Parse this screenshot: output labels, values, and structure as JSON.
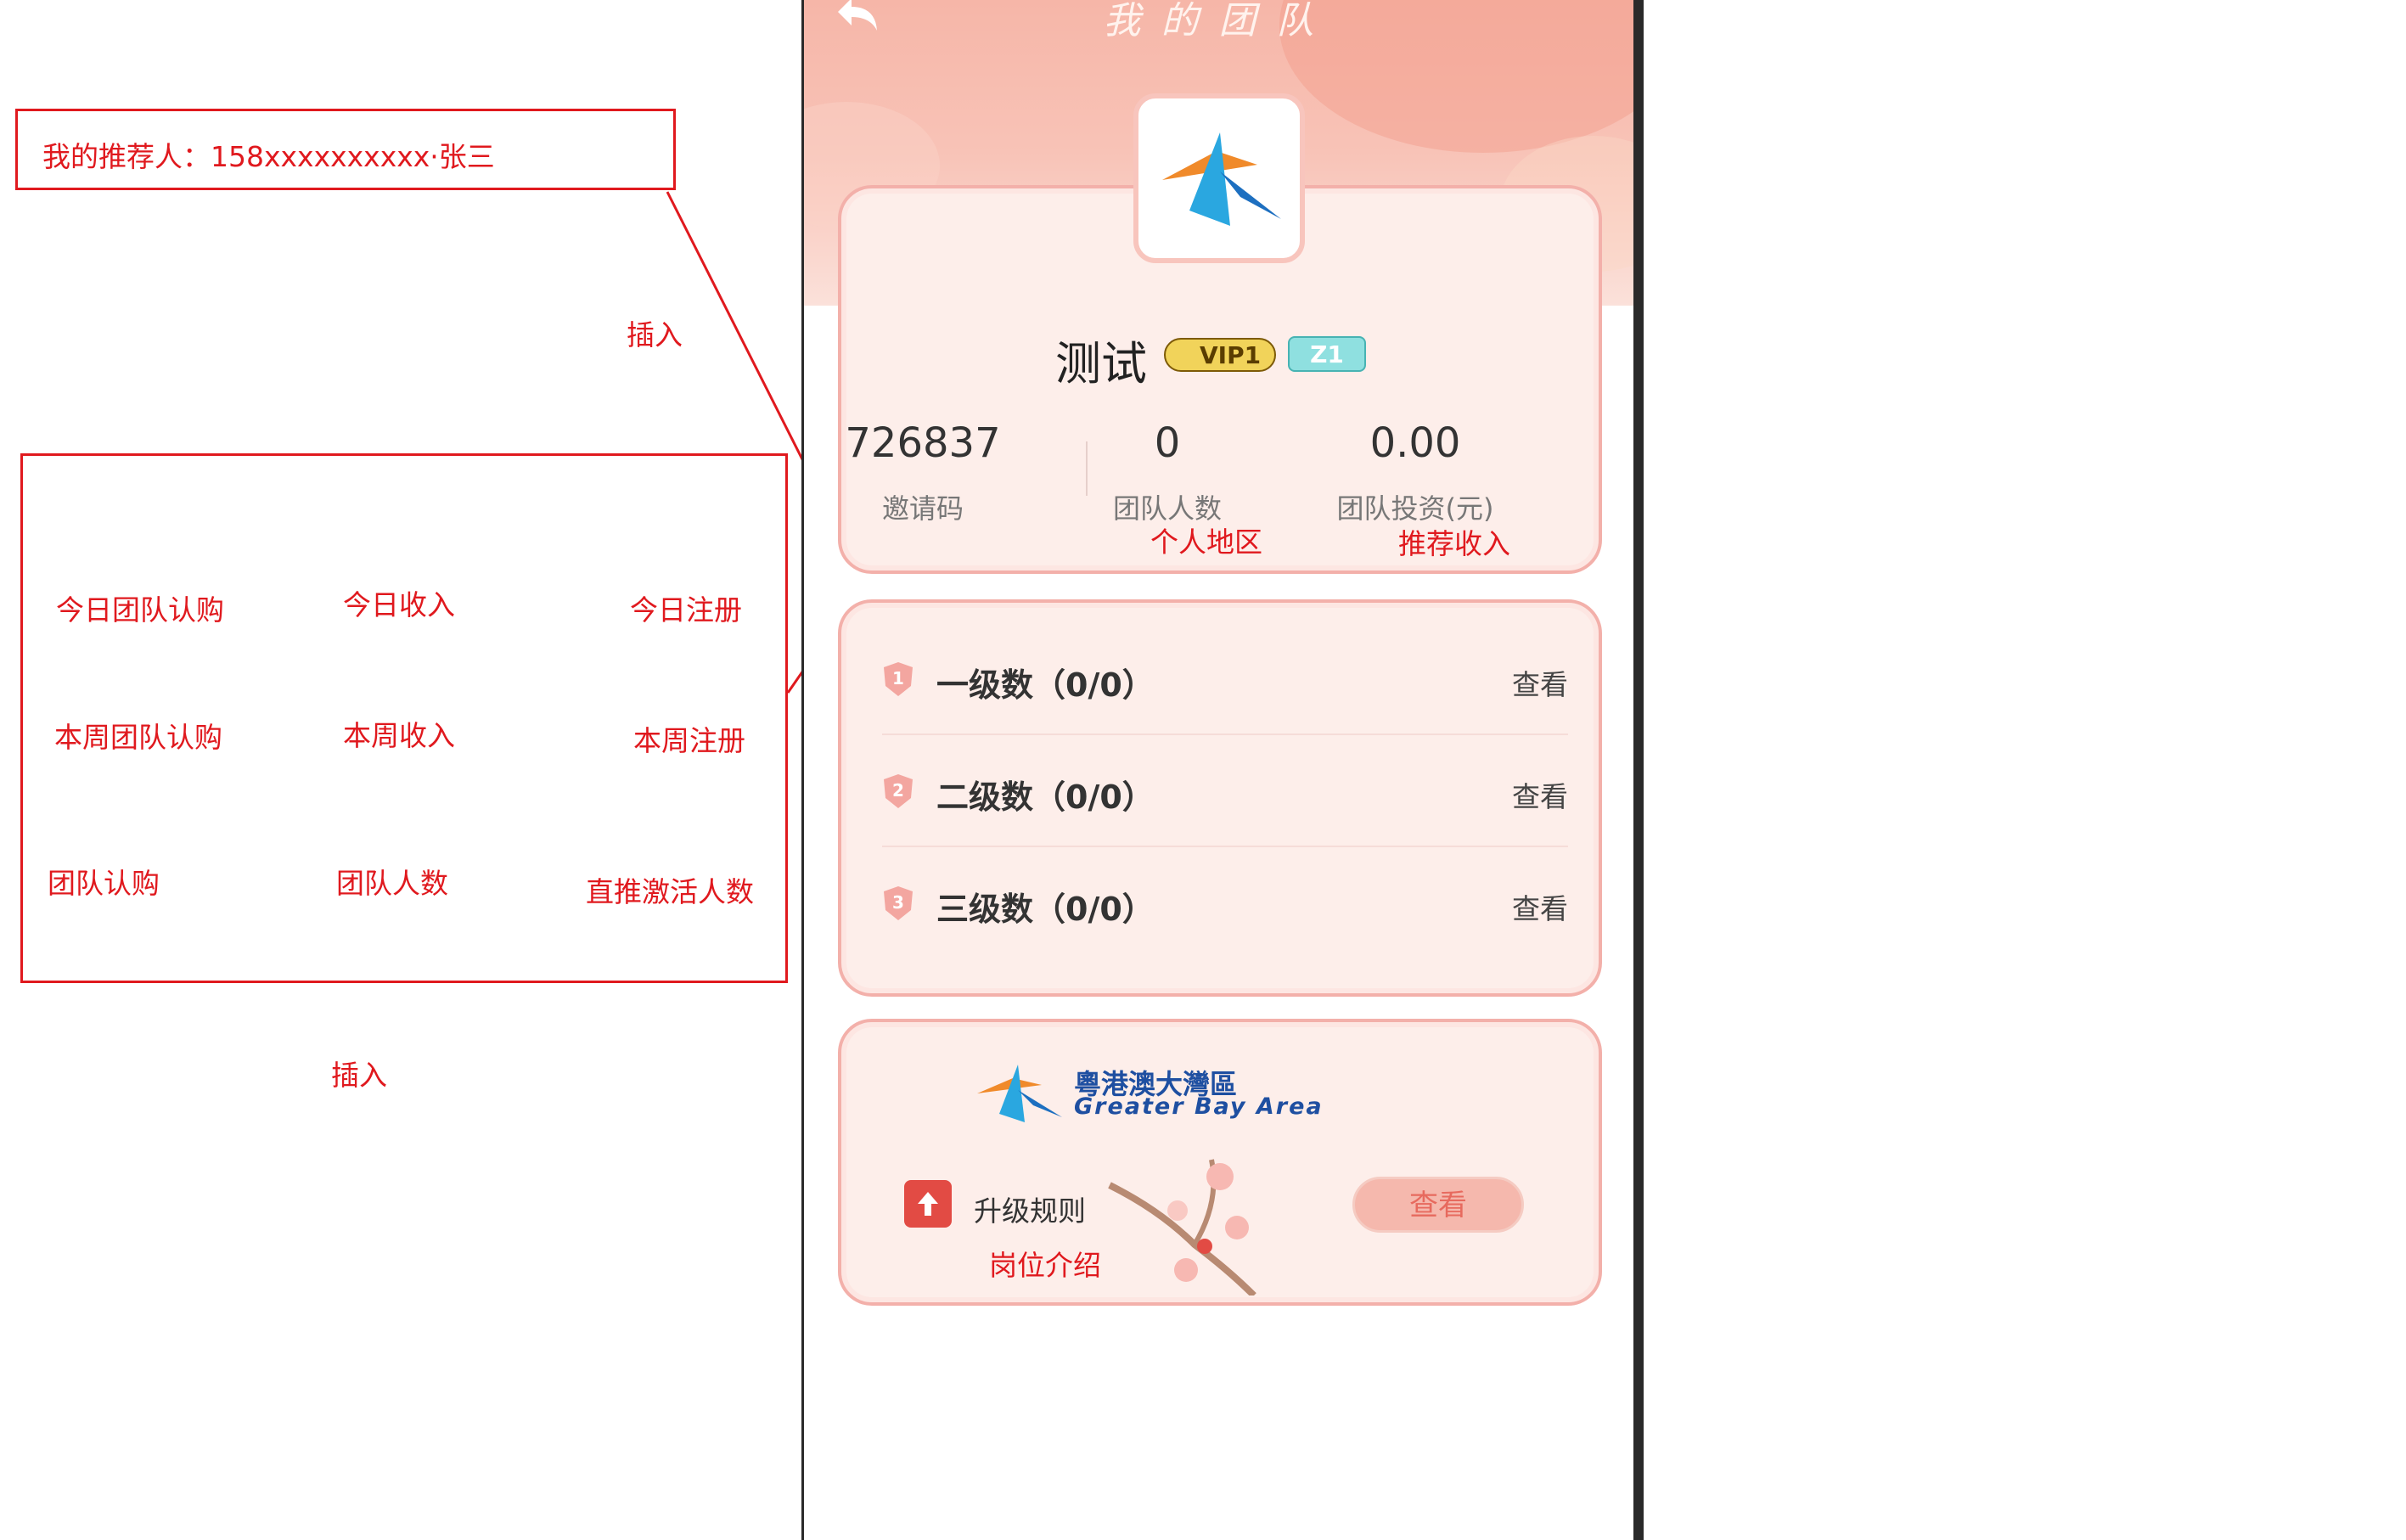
{
  "annotation": {
    "recommender": "我的推荐人：158xxxxxxxxxx·张三",
    "insert_top": "插入",
    "insert_bottom": "插入",
    "grid": [
      [
        "今日团队认购",
        "今日收入",
        "今日注册"
      ],
      [
        "本周团队认购",
        "本周收入",
        "本周注册"
      ],
      [
        "团队认购",
        "团队人数",
        "直推激活人数"
      ]
    ],
    "notes": {
      "personal_region": "个人地区",
      "recommend_income": "推荐收入",
      "position_intro": "岗位介绍"
    },
    "color": "#e0191e"
  },
  "phone": {
    "title": "我的团队",
    "back_icon": "back-arrow-icon",
    "user": {
      "name": "测试",
      "vip_badge": "VIP1",
      "zi_badge": "Z1"
    },
    "stats": [
      {
        "value": "726837",
        "label": "邀请码"
      },
      {
        "value": "0",
        "label": "团队人数"
      },
      {
        "value": "0.00",
        "label": "团队投资(元)"
      }
    ],
    "levels": [
      {
        "index": "1",
        "label": "一级数（0/0）",
        "action": "查看"
      },
      {
        "index": "2",
        "label": "二级数（0/0）",
        "action": "查看"
      },
      {
        "index": "3",
        "label": "三级数（0/0）",
        "action": "查看"
      }
    ],
    "gba": {
      "title_cn": "粵港澳大灣區",
      "title_en": "Greater Bay Area"
    },
    "upgrade": {
      "label": "升级规则",
      "button": "查看"
    },
    "colors": {
      "header": "#f6b6a8",
      "card_border": "#f3b0aa",
      "card_bg": "#fdeeea",
      "accent": "#e76a5e"
    }
  }
}
